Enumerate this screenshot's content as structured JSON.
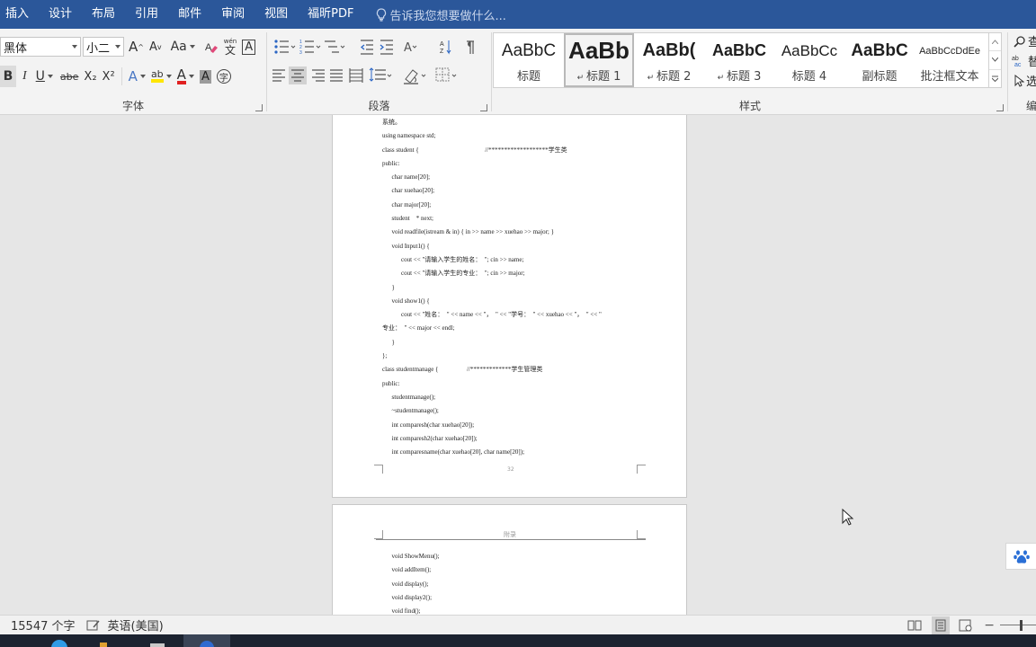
{
  "tabs": [
    "插入",
    "设计",
    "布局",
    "引用",
    "邮件",
    "审阅",
    "视图",
    "福昕PDF"
  ],
  "tell_me": "告诉我您想要做什么...",
  "font": {
    "name": "黑体",
    "size": "小二",
    "grow": "A",
    "shrink": "A",
    "case": "Aa",
    "phonetic_top": "wén",
    "phonetic_bottom": "文",
    "border_char": "A",
    "bold": "B",
    "italic": "I",
    "underline": "U",
    "strike": "abe",
    "sub": "X₂",
    "sup": "X²",
    "effect": "A",
    "highlight": "ab",
    "color": "A",
    "shade": "A",
    "circle": "字",
    "label": "字体"
  },
  "paragraph": {
    "label": "段落"
  },
  "styles": {
    "label": "样式",
    "items": [
      {
        "sample": "AaBbC",
        "name": "标题",
        "size": 19,
        "bold": false,
        "mark": false
      },
      {
        "sample": "AaBb",
        "name": "标题 1",
        "size": 26,
        "bold": true,
        "mark": true
      },
      {
        "sample": "AaBb(",
        "name": "标题 2",
        "size": 20,
        "bold": true,
        "mark": true
      },
      {
        "sample": "AaBbC",
        "name": "标题 3",
        "size": 18,
        "bold": true,
        "mark": true
      },
      {
        "sample": "AaBbCc",
        "name": "标题 4",
        "size": 17,
        "bold": false,
        "mark": false
      },
      {
        "sample": "AaBbC",
        "name": "副标题",
        "size": 19,
        "bold": true,
        "mark": false
      },
      {
        "sample": "AaBbCcDdEe",
        "name": "批注框文本",
        "size": 11,
        "bold": false,
        "mark": false
      }
    ]
  },
  "right_group": {
    "find": "查",
    "replace": "替",
    "select": "选",
    "label": "编"
  },
  "page1_lines": [
    "系统。",
    "using namespace std;",
    "class student {                                          //*******************学生类",
    "public:",
    "      char name[20];",
    "      char xuehao[20];",
    "      char major[20];",
    "      student    * next;",
    "      void readfile(istream & in) { in >> name >> xuehao >> major; }",
    "      void Input1() {",
    "            cout << \"请输入学生的姓名：  \"; cin >> name;",
    "            cout << \"请输入学生的专业：  \"; cin >> major;",
    "      }",
    "      void show1() {",
    "            cout << \"姓名：  \" << name << \"，  \" << \"学号：  \" << xuehao << \"，  \" << \"",
    "专业：  \" << major << endl;",
    "      }",
    "};",
    "class studentmanage {                  //*************学生管理类",
    "public:",
    "      studentmanage();",
    "      ~studentmanage();",
    "      int comparesh(char xuehao[20]);",
    "      int comparesh2(char xuehao[20]);",
    "      int comparesname(char xuehao[20], char name[20]);"
  ],
  "page1_number": "32",
  "page2_header": "附录",
  "page2_lines": [
    "      void ShowMenu();",
    "      void addItem();",
    "      void display();",
    "      void display2();",
    "      void find();"
  ],
  "status": {
    "word_count": "15547 个字",
    "language": "英语(美国)"
  }
}
